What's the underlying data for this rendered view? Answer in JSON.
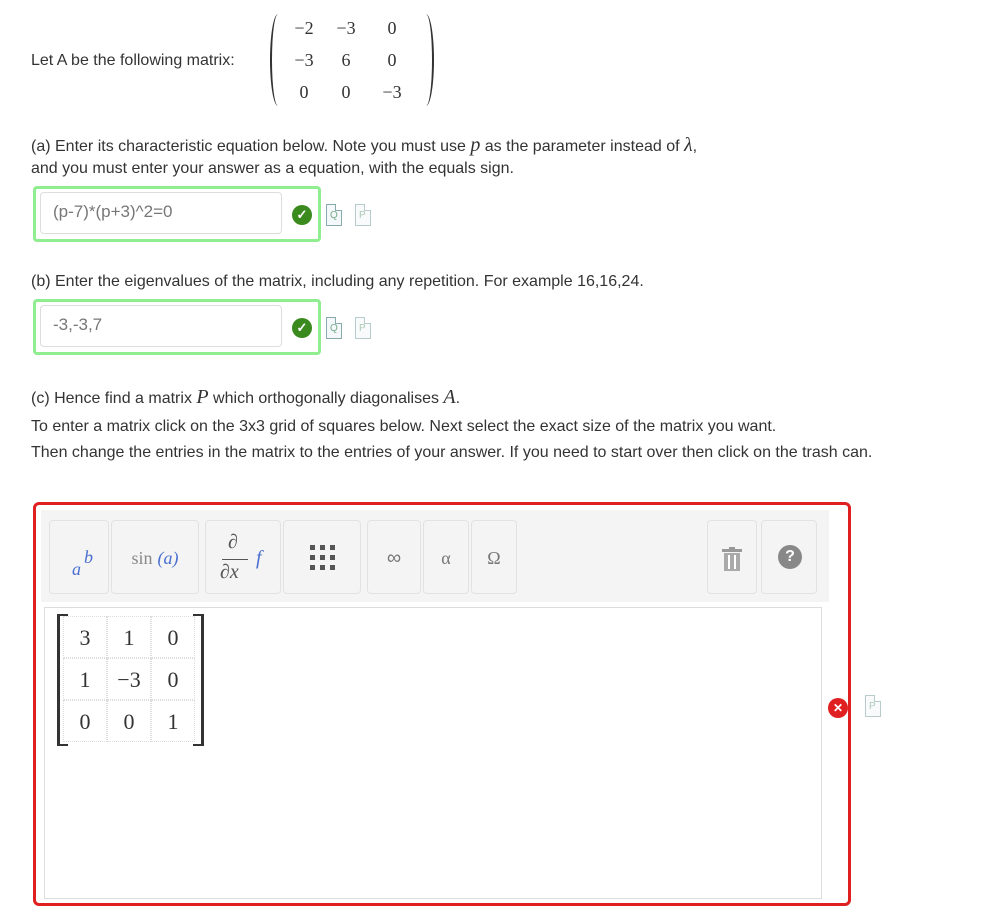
{
  "intro": {
    "label": "Let A be the following matrix:",
    "matrix": [
      [
        "−2",
        "−3",
        "0"
      ],
      [
        "−3",
        "6",
        "0"
      ],
      [
        "0",
        "0",
        "−3"
      ]
    ]
  },
  "part_a": {
    "line1_pre": "(a) Enter its characteristic equation below. Note you must use ",
    "param": "p",
    "line1_mid": " as the parameter instead of ",
    "lambda": "λ",
    "line1_post": ",",
    "line2": "and you must enter your answer as a equation, with the equals sign.",
    "answer": "(p-7)*(p+3)^2=0",
    "status": "correct"
  },
  "part_b": {
    "text": "(b) Enter the eigenvalues of the matrix, including any repetition. For example 16,16,24.",
    "answer": "-3,-3,7",
    "status": "correct"
  },
  "part_c": {
    "line1_pre": "(c) Hence find a matrix ",
    "P": "P",
    "line1_mid": " which orthogonally diagonalises ",
    "A": "A",
    "line1_post": ".",
    "line2": "To enter a matrix click on the 3x3 grid of squares below. Next select the exact size of the matrix you want.",
    "line3": "Then change the entries in the matrix to the entries of your answer. If you need to start over then click on the trash can.",
    "matrix": [
      [
        "3",
        "1",
        "0"
      ],
      [
        "1",
        "−3",
        "0"
      ],
      [
        "0",
        "0",
        "1"
      ]
    ],
    "status": "incorrect"
  },
  "toolbar": {
    "power_base": "a",
    "power_exp": "b",
    "sin_label": "sin",
    "sin_arg": "(a)",
    "deriv_top": "∂",
    "deriv_bottom": "∂x",
    "deriv_f": "f",
    "infinity": "∞",
    "alpha": "α",
    "omega": "Ω",
    "help": "?"
  },
  "icons": {
    "check": "check-icon",
    "cross": "cross-icon",
    "preview": "preview-icon",
    "doc": "doc-icon",
    "trash": "trash-icon",
    "matrix": "matrix-grid-icon"
  },
  "colors": {
    "correct_border": "#90ee90",
    "incorrect_border": "#e02020",
    "check_green": "#3a8a1e"
  }
}
